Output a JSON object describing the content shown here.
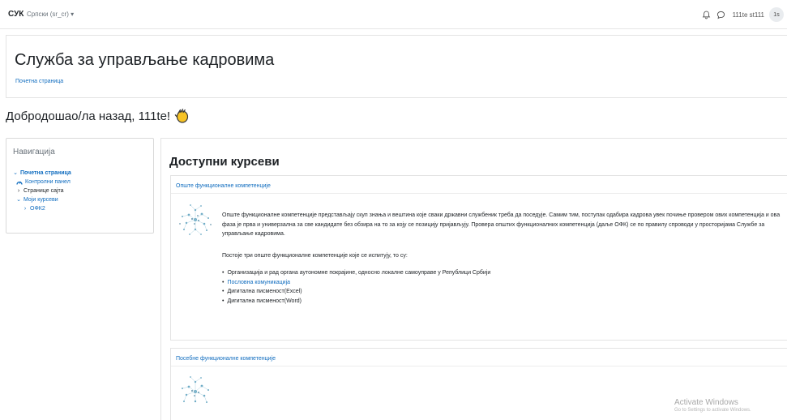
{
  "navbar": {
    "brand": "СУК",
    "language": "Српски (sr_cr) ▾",
    "username": "111te st111",
    "avatar_initials": "1s"
  },
  "header": {
    "site_title": "Служба за управљање кадровима",
    "breadcrumb": "Почетна страница"
  },
  "welcome": {
    "text": "Добродошао/ла назад, 111te!"
  },
  "navigation_block": {
    "title": "Навигација",
    "home": "Почетна страница",
    "dashboard": "Контролни панел",
    "site_pages": "Странице сајта",
    "my_courses": "Моји курсеви",
    "course_ofk2": "ОФК2"
  },
  "main": {
    "title": "Доступни курсеви",
    "courses": [
      {
        "name": "Опште функционалне компетенције",
        "summary": "Опште функционалне компетенције представљају скуп знања и вештина које сваки државни службеник треба да поседује. Самим тим, поступак одабира кадрова увек почиње провером ових компетенција и ова фаза је прва и универзална за све кандидате без обзира на то за коју се позицију пријављују. Провера општих функционалних компетенција (даље ОФК) се по правилу спроводи у просторијама Службе за управљање кадровима.",
        "intro": "Постоје три опште функционалне компетенције које се испитују, то су:",
        "bullets": [
          "Организација и рад органа аутономне покрајине, односно локалне самоуправе у Републици Србији",
          "Пословна комуникација",
          "Дигитална писменост(Excel)",
          "Дигитална писменост(Word)"
        ]
      },
      {
        "name": "Посебне функционалне компетенције"
      }
    ]
  },
  "watermark": {
    "title": "Activate Windows",
    "subtitle": "Go to Settings to activate Windows."
  },
  "colors": {
    "link": "#0f6cbf",
    "text": "#1d2125",
    "muted": "#6a737b",
    "border": "#e3e3e3"
  }
}
